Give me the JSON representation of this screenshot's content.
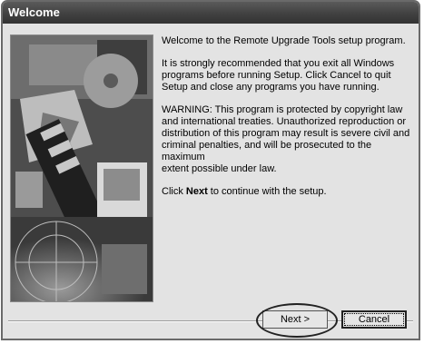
{
  "window": {
    "title": "Welcome"
  },
  "image": {
    "description_icon": "setup-collage-image"
  },
  "text": {
    "p1": "Welcome to the Remote Upgrade Tools setup program.",
    "p2": "It is strongly recommended that you exit all Windows\nprograms before running Setup.  Click Cancel to quit\nSetup and close any programs you have running.",
    "p3": "WARNING: This program is protected by copyright law\nand international treaties.  Unauthorized reproduction or\ndistribution of this program may result is severe civil and\ncriminal penalties, and will be prosecuted to the maximum\nextent possible under law.",
    "p4_before": "Click ",
    "p4_bold": "Next",
    "p4_after": " to continue with the setup."
  },
  "buttons": {
    "next_label": "Next >",
    "cancel_label": "Cancel"
  }
}
